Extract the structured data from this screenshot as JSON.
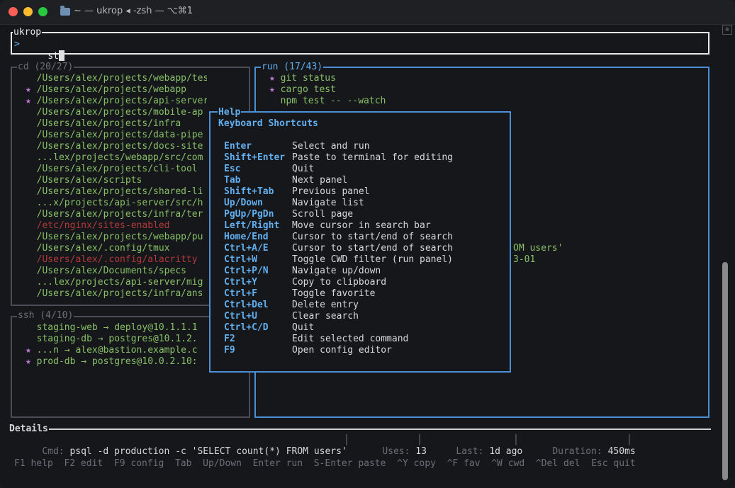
{
  "window": {
    "title": "~ — ukrop ◂ -zsh — ⌥⌘1"
  },
  "search": {
    "label": "ukrop",
    "prompt": ">",
    "query": "st"
  },
  "cd_panel": {
    "title": "cd (20/27)",
    "items": [
      {
        "star": false,
        "text": "/Users/alex/projects/webapp/tests",
        "color": "green"
      },
      {
        "star": true,
        "text": "/Users/alex/projects/webapp",
        "color": "green"
      },
      {
        "star": true,
        "text": "/Users/alex/projects/api-server",
        "color": "green"
      },
      {
        "star": false,
        "text": "/Users/alex/projects/mobile-ap",
        "color": "green"
      },
      {
        "star": false,
        "text": "/Users/alex/projects/infra",
        "color": "green"
      },
      {
        "star": false,
        "text": "/Users/alex/projects/data-pipe",
        "color": "green"
      },
      {
        "star": false,
        "text": "/Users/alex/projects/docs-site",
        "color": "green"
      },
      {
        "star": false,
        "text": "...lex/projects/webapp/src/com",
        "color": "green"
      },
      {
        "star": false,
        "text": "/Users/alex/projects/cli-tool",
        "color": "green"
      },
      {
        "star": false,
        "text": "/Users/alex/scripts",
        "color": "green"
      },
      {
        "star": false,
        "text": "/Users/alex/projects/shared-li",
        "color": "green"
      },
      {
        "star": false,
        "text": "...x/projects/api-server/src/h",
        "color": "green"
      },
      {
        "star": false,
        "text": "/Users/alex/projects/infra/ter",
        "color": "green"
      },
      {
        "star": false,
        "text": "/etc/nginx/sites-enabled",
        "color": "red"
      },
      {
        "star": false,
        "text": "/Users/alex/projects/webapp/pu",
        "color": "green"
      },
      {
        "star": false,
        "text": "/Users/alex/.config/tmux",
        "color": "green"
      },
      {
        "star": false,
        "text": "/Users/alex/.config/alacritty",
        "color": "red"
      },
      {
        "star": false,
        "text": "/Users/alex/Documents/specs",
        "color": "green"
      },
      {
        "star": false,
        "text": "...lex/projects/api-server/mig",
        "color": "green"
      },
      {
        "star": false,
        "text": "/Users/alex/projects/infra/ans",
        "color": "green"
      }
    ]
  },
  "ssh_panel": {
    "title": "ssh (4/10)",
    "items": [
      {
        "star": false,
        "text": "staging-web → deploy@10.1.1.1"
      },
      {
        "star": false,
        "text": "staging-db → postgres@10.1.2."
      },
      {
        "star": true,
        "text": "...n → alex@bastion.example.c"
      },
      {
        "star": true,
        "text": "prod-db → postgres@10.0.2.10:"
      }
    ]
  },
  "run_panel": {
    "title": "run (17/43)",
    "items": [
      {
        "star": true,
        "text": "git status"
      },
      {
        "star": true,
        "text": "cargo test"
      },
      {
        "star": false,
        "text": "npm test -- --watch"
      }
    ],
    "partial_visible": [
      "OM users'",
      "3-01"
    ]
  },
  "help": {
    "title": "Help",
    "heading": "Keyboard Shortcuts",
    "shortcuts": [
      {
        "key": "Enter",
        "desc": "Select and run"
      },
      {
        "key": "Shift+Enter",
        "desc": "Paste to terminal for editing"
      },
      {
        "key": "Esc",
        "desc": "Quit"
      },
      {
        "key": "Tab",
        "desc": "Next panel"
      },
      {
        "key": "Shift+Tab",
        "desc": "Previous panel"
      },
      {
        "key": "Up/Down",
        "desc": "Navigate list"
      },
      {
        "key": "PgUp/PgDn",
        "desc": "Scroll page"
      },
      {
        "key": "Left/Right",
        "desc": "Move cursor in search bar"
      },
      {
        "key": "Home/End",
        "desc": "Cursor to start/end of search"
      },
      {
        "key": "Ctrl+A/E",
        "desc": "Cursor to start/end of search"
      },
      {
        "key": "Ctrl+W",
        "desc": "Toggle CWD filter (run panel)"
      },
      {
        "key": "Ctrl+P/N",
        "desc": "Navigate up/down"
      },
      {
        "key": "Ctrl+Y",
        "desc": "Copy to clipboard"
      },
      {
        "key": "Ctrl+F",
        "desc": "Toggle favorite"
      },
      {
        "key": "Ctrl+Del",
        "desc": "Delete entry"
      },
      {
        "key": "Ctrl+U",
        "desc": "Clear search"
      },
      {
        "key": "Ctrl+C/D",
        "desc": "Quit"
      },
      {
        "key": "F2",
        "desc": "Edit selected command"
      },
      {
        "key": "F9",
        "desc": "Open config editor"
      }
    ]
  },
  "details": {
    "title": "Details",
    "cmd_label": "Cmd:",
    "cmd_value": "psql -d production -c 'SELECT count(*) FROM users'",
    "uses_label": "Uses:",
    "uses_value": "13",
    "last_label": "Last:",
    "last_value": "1d ago",
    "duration_label": "Duration:",
    "duration_value": "450ms"
  },
  "footer": {
    "hints": [
      "F1 help",
      "F2 edit",
      "F9 config",
      "Tab",
      "Up/Down",
      "Enter run",
      "S-Enter paste",
      "^Y copy",
      "^F fav",
      "^W cwd",
      "^Del del",
      "Esc quit"
    ]
  },
  "colors": {
    "background": "#16171b",
    "accent_blue": "#61afef",
    "path_green": "#88c066",
    "missing_red": "#b23a3a",
    "star_magenta": "#c678dd",
    "match_orange": "#e5a34f"
  }
}
